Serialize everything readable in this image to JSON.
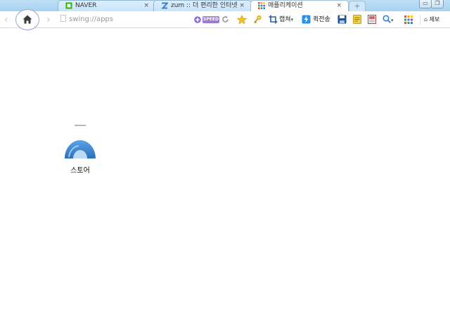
{
  "tabs": [
    {
      "label": "NAVER",
      "close": "×",
      "icon": "naver-icon"
    },
    {
      "label": "zum :: 더 편리한 인터넷",
      "close": "×",
      "icon": "zum-icon"
    },
    {
      "label": "애플리케이션",
      "close": "×",
      "icon": "apps-grid-icon",
      "active": true
    }
  ],
  "new_tab": "+",
  "window": {
    "minimize": "▭",
    "restore": "❐"
  },
  "toolbar": {
    "address": "swing://apps",
    "speed_badge": "SPEED",
    "capture_label": "캡쳐",
    "send_label": "퀵전송",
    "more_label": "제보"
  },
  "apps": [
    {
      "label": "스토어"
    }
  ],
  "colors": {
    "tab_active": "#ffffff",
    "tab_inactive": "#c6e4fa",
    "accent": "#3a7fd0"
  }
}
